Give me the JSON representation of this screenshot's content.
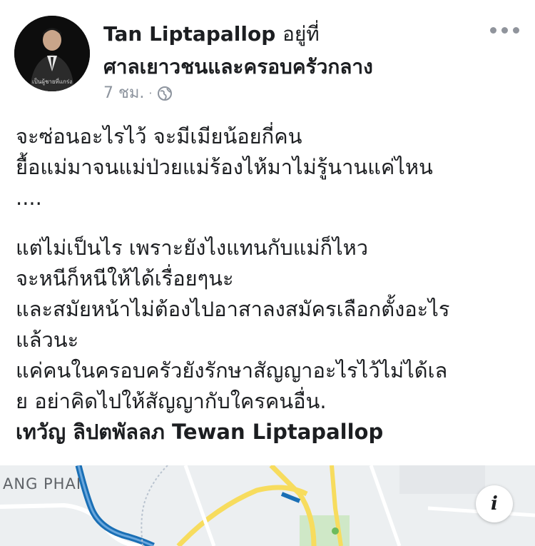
{
  "post": {
    "author": "Tan Liptapallop",
    "at_text": "อยู่ที่",
    "location": "ศาลเยาวชนและครอบครัวกลาง",
    "time": "7 ชม.",
    "time_separator": "·",
    "privacy_icon": "globe-icon",
    "more_icon": "ellipsis-icon",
    "body_lines_1": [
      "จะซ่อนอะไรไว้ จะมีเมียน้อยกี่คน",
      "ยื้อแม่มาจนแม่ป่วยแม่ร้องไห้มาไม่รู้นานแค่ไหน",
      "...."
    ],
    "body_lines_2": [
      "แต่ไม่เป็นไร เพราะยังไงแทนกับแม่ก็ไหว",
      "จะหนีก็หนีให้ได้เรื่อยๆนะ",
      "และสมัยหน้าไม่ต้องไปอาสาลงสมัครเลือกตั้งอะไร",
      "แล้วนะ",
      "แค่คนในครอบครัวยังรักษาสัญญาอะไรไว้ไม่ได้เล",
      "ย อย่าคิดไปให้สัญญากับใครคนอื่น."
    ],
    "signature": "เทวัญ ลิปตพัลลภ Tewan Liptapallop"
  },
  "map": {
    "label": "ANG PHAI",
    "info_icon": "info-icon",
    "info_glyph": "i"
  },
  "colors": {
    "text": "#1c1e21",
    "meta": "#8d949e",
    "map_bg": "#eceff1",
    "road_yellow": "#f7dc5e",
    "river_blue": "#1a6fb5"
  }
}
